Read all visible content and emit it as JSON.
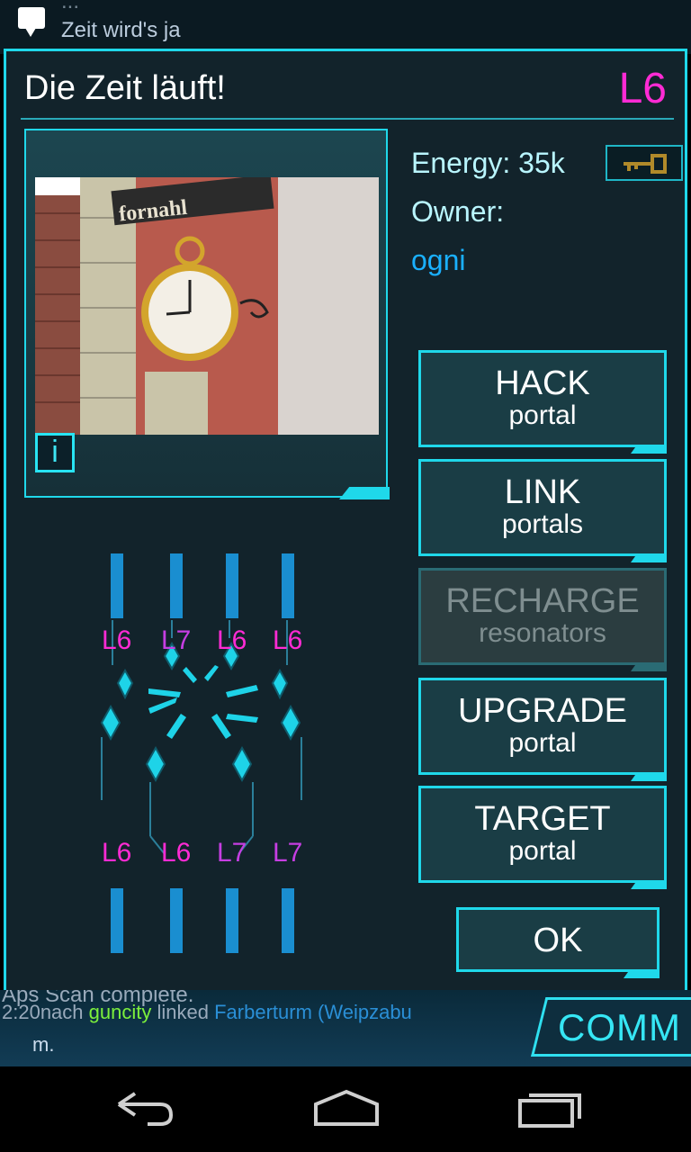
{
  "background_comm": {
    "line_top_partial": "...",
    "line_second": "Zeit wird's ja"
  },
  "dialog": {
    "title": "Die Zeit läuft!",
    "level": "L6",
    "energy_label": "Energy:",
    "energy_value": "35k",
    "owner_label": "Owner:",
    "owner_name": "ogni",
    "info_label": "i"
  },
  "buttons": [
    {
      "main": "HACK",
      "sub": "portal",
      "enabled": true
    },
    {
      "main": "LINK",
      "sub": "portals",
      "enabled": true
    },
    {
      "main": "RECHARGE",
      "sub": "resonators",
      "enabled": false
    },
    {
      "main": "UPGRADE",
      "sub": "portal",
      "enabled": true
    },
    {
      "main": "TARGET",
      "sub": "portal",
      "enabled": true
    }
  ],
  "ok_label": "OK",
  "resonators_top": [
    "L6",
    "L7",
    "L6",
    "L6"
  ],
  "resonators_bottom": [
    "L6",
    "L6",
    "L7",
    "L7"
  ],
  "bottom_comm": {
    "line1": "Aps Scan complete.",
    "line2_time": "2:20nach",
    "line2_player": "guncity",
    "line2_action": "linked",
    "line2_portal1": "Farberturm",
    "line2_portal2": "(Weipzabu",
    "line3": "m.",
    "comm_label": "COMM"
  },
  "colors": {
    "accent": "#1fd8ea",
    "level": "#ff2bd4",
    "owner": "#1ab0ff",
    "player": "#7cf03c"
  }
}
